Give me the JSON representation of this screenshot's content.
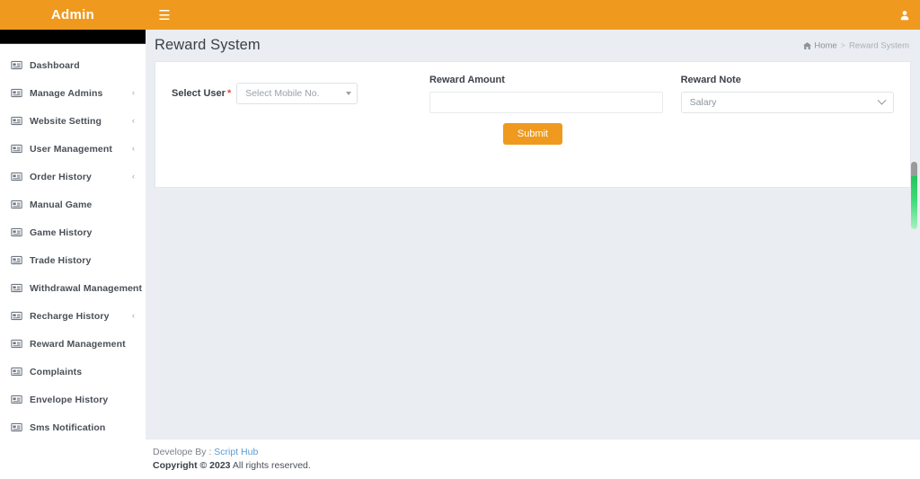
{
  "topbar": {
    "brand": "Admin",
    "menu_icon": "hamburger-icon",
    "user_icon": "user-icon"
  },
  "sidebar": {
    "items": [
      {
        "label": "Dashboard",
        "icon": "window-icon",
        "caret": ""
      },
      {
        "label": "Manage Admins",
        "icon": "window-icon",
        "caret": "‹"
      },
      {
        "label": "Website Setting",
        "icon": "window-icon",
        "caret": "‹"
      },
      {
        "label": "User Management",
        "icon": "window-icon",
        "caret": "‹"
      },
      {
        "label": "Order History",
        "icon": "window-icon",
        "caret": "‹"
      },
      {
        "label": "Manual Game",
        "icon": "window-icon",
        "caret": ""
      },
      {
        "label": "Game History",
        "icon": "window-icon",
        "caret": ""
      },
      {
        "label": "Trade History",
        "icon": "window-icon",
        "caret": ""
      },
      {
        "label": "Withdrawal Management",
        "icon": "window-icon",
        "caret": "‹"
      },
      {
        "label": "Recharge History",
        "icon": "window-icon",
        "caret": "‹"
      },
      {
        "label": "Reward Management",
        "icon": "window-icon",
        "caret": ""
      },
      {
        "label": "Complaints",
        "icon": "window-icon",
        "caret": ""
      },
      {
        "label": "Envelope History",
        "icon": "window-icon",
        "caret": ""
      },
      {
        "label": "Sms Notification",
        "icon": "window-icon",
        "caret": ""
      }
    ]
  },
  "page": {
    "title": "Reward System",
    "breadcrumb": {
      "home_icon": "home-icon",
      "home": "Home",
      "separator": ">",
      "current": "Reward System"
    }
  },
  "form": {
    "select_user": {
      "label": "Select User",
      "required_marker": "*",
      "placeholder": "Select Mobile No.",
      "value": ""
    },
    "reward_amount": {
      "label": "Reward Amount",
      "value": "",
      "placeholder": ""
    },
    "reward_note": {
      "label": "Reward Note",
      "selected": "Salary",
      "options": [
        "Salary"
      ]
    },
    "submit_label": "Submit"
  },
  "footer": {
    "developed_by_prefix": "Develope By : ",
    "developer": "Script Hub",
    "copyright_bold": "Copyright © 2023",
    "copyright_rest": " All rights reserved."
  },
  "colors": {
    "brand_orange": "#ef9a1e",
    "content_bg": "#eaedf2",
    "scrollbar_green": "#22c55e",
    "required_red": "#e74c3c",
    "link_blue": "#5b9bd5"
  }
}
